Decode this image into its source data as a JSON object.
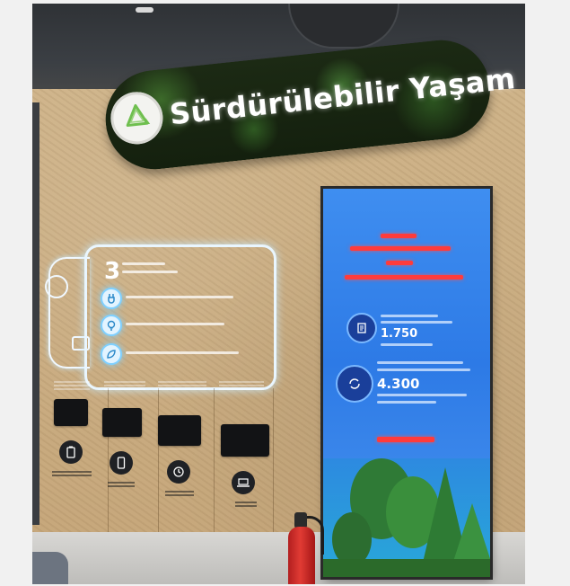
{
  "sign": {
    "title": "Sürdürülebilir Yaşam",
    "icon": "recycle-icon"
  },
  "energy_panel": {
    "number": "3",
    "icons": [
      "plug-icon",
      "bulb-icon",
      "leaf-icon"
    ]
  },
  "charging_stations": {
    "count": 4,
    "icons": [
      "battery-icon",
      "phone-icon",
      "clock-icon",
      "laptop-icon"
    ]
  },
  "led_screen": {
    "figure_1": "1.750",
    "figure_2": "4.300",
    "icons": [
      "document-icon",
      "cycle-icon"
    ]
  },
  "colors": {
    "wall": "#c6a77b",
    "sign_background": "#14200e",
    "screen_blue": "#2d7ae6",
    "accent_red": "#ff3b3b",
    "glow": "#e9f6ff"
  }
}
